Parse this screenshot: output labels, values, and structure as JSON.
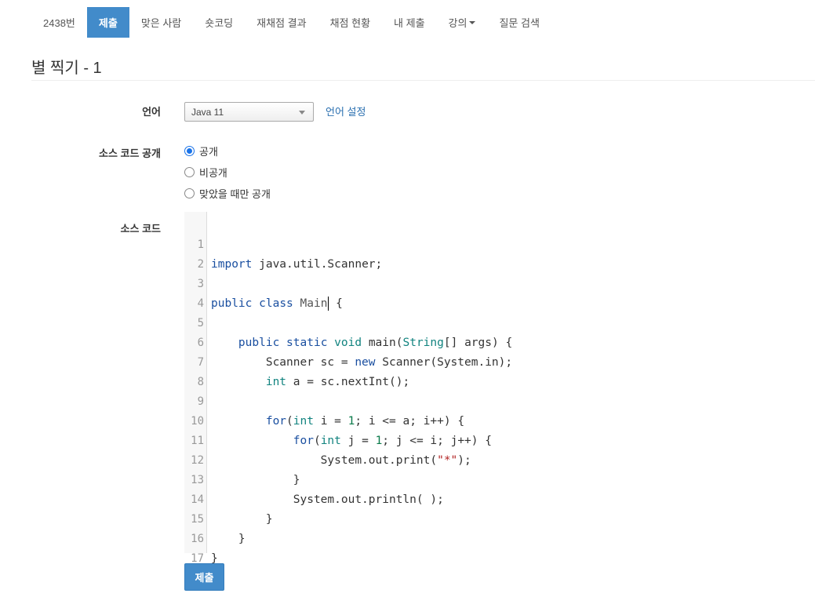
{
  "nav": {
    "tabs": [
      {
        "label": "2438번",
        "active": false
      },
      {
        "label": "제출",
        "active": true
      },
      {
        "label": "맞은 사람",
        "active": false
      },
      {
        "label": "숏코딩",
        "active": false
      },
      {
        "label": "재채점 결과",
        "active": false
      },
      {
        "label": "채점 현황",
        "active": false
      },
      {
        "label": "내 제출",
        "active": false
      },
      {
        "label": "강의",
        "active": false,
        "dropdown": true
      },
      {
        "label": "질문 검색",
        "active": false
      }
    ]
  },
  "page": {
    "title": "별 찍기",
    "title_suffix": " - 1"
  },
  "form": {
    "language_label": "언어",
    "language_value": "Java 11",
    "language_settings_link": "언어 설정",
    "visibility_label": "소스 코드 공개",
    "visibility_options": [
      {
        "label": "공개",
        "checked": true
      },
      {
        "label": "비공개",
        "checked": false
      },
      {
        "label": "맞았을 때만 공개",
        "checked": false
      }
    ],
    "source_label": "소스 코드",
    "submit_label": "제출"
  },
  "editor": {
    "line_numbers": [
      "1",
      "2",
      "3",
      "4",
      "5",
      "6",
      "7",
      "8",
      "9",
      "10",
      "11",
      "12",
      "13",
      "14",
      "15",
      "16",
      "17"
    ],
    "lines": [
      "import java.util.Scanner;",
      "",
      "public class Main {",
      "",
      "    public static void main(String[] args) {",
      "        Scanner sc = new Scanner(System.in);",
      "        int a = sc.nextInt();",
      "",
      "        for(int i = 1; i <= a; i++) {",
      "            for(int j = 1; j <= i; j++) {",
      "                System.out.print(\"*\");",
      "            }",
      "            System.out.println( );",
      "        }",
      "    }",
      "}",
      ""
    ]
  }
}
